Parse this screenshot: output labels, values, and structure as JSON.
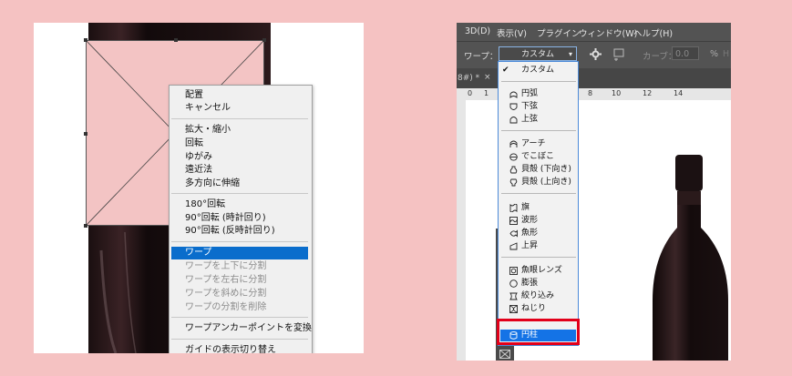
{
  "left_menu": {
    "items": [
      {
        "label": "配置",
        "disabled": false
      },
      {
        "label": "キャンセル",
        "disabled": false
      },
      {
        "label": "拡大・縮小",
        "disabled": false
      },
      {
        "label": "回転",
        "disabled": false
      },
      {
        "label": "ゆがみ",
        "disabled": false
      },
      {
        "label": "遠近法",
        "disabled": false
      },
      {
        "label": "多方向に伸縮",
        "disabled": false
      },
      {
        "label": "180°回転",
        "disabled": false
      },
      {
        "label": "90°回転 (時計回り)",
        "disabled": false
      },
      {
        "label": "90°回転 (反時計回り)",
        "disabled": false
      },
      {
        "label": "ワープ",
        "disabled": false,
        "selected": true
      },
      {
        "label": "ワープを上下に分割",
        "disabled": true
      },
      {
        "label": "ワープを左右に分割",
        "disabled": true
      },
      {
        "label": "ワープを斜めに分割",
        "disabled": true
      },
      {
        "label": "ワープの分割を削除",
        "disabled": true
      },
      {
        "label": "ワープアンカーポイントを変換",
        "disabled": false
      },
      {
        "label": "ガイドの表示切り替え",
        "disabled": false
      }
    ]
  },
  "ps": {
    "menubar": [
      "3D(D)",
      "表示(V)",
      "プラグイン",
      "ウィンドウ(W)",
      "ヘルプ(H)"
    ],
    "options": {
      "warp_label": "ワープ：",
      "warp_value": "カスタム",
      "curve_label": "カーブ：",
      "curve_value": "0.0",
      "percent": "%",
      "h_label": "H"
    },
    "tab_text": "8#) *",
    "tab_close": "×",
    "ruler": [
      "0",
      "1",
      "8",
      "10",
      "12",
      "14"
    ],
    "dropdown": [
      {
        "label": "カスタム",
        "checked": true,
        "icon": "check-icon"
      },
      {
        "label": "円弧",
        "icon": "arc-icon"
      },
      {
        "label": "下弦",
        "icon": "arc-lower-icon"
      },
      {
        "label": "上弦",
        "icon": "arc-upper-icon"
      },
      {
        "label": "アーチ",
        "icon": "arch-icon"
      },
      {
        "label": "でこぼこ",
        "icon": "bulge-icon"
      },
      {
        "label": "貝殻 (下向き)",
        "icon": "shell-lower-icon"
      },
      {
        "label": "貝殻 (上向き)",
        "icon": "shell-upper-icon"
      },
      {
        "label": "旗",
        "icon": "flag-icon"
      },
      {
        "label": "波形",
        "icon": "wave-icon"
      },
      {
        "label": "魚形",
        "icon": "fish-icon"
      },
      {
        "label": "上昇",
        "icon": "rise-icon"
      },
      {
        "label": "魚眼レンズ",
        "icon": "fisheye-icon"
      },
      {
        "label": "膨張",
        "icon": "inflate-icon"
      },
      {
        "label": "絞り込み",
        "icon": "squeeze-icon"
      },
      {
        "label": "ねじり",
        "icon": "twist-icon"
      },
      {
        "label": "円柱",
        "icon": "cylinder-icon",
        "selected": true
      }
    ]
  }
}
